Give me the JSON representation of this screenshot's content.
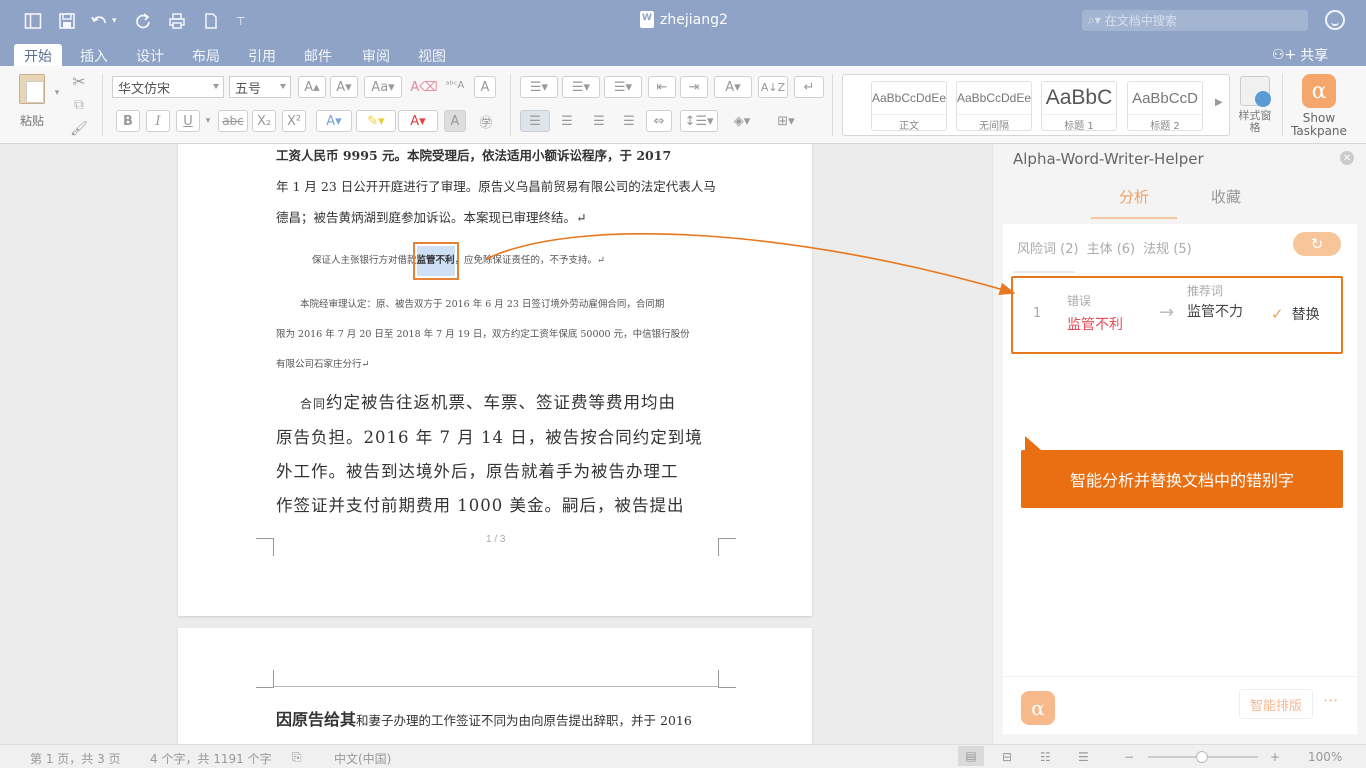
{
  "titlebar": {
    "doc_title": "zhejiang2",
    "search_placeholder": "在文档中搜索"
  },
  "tabs": [
    {
      "label": "开始",
      "active": true
    },
    {
      "label": "插入"
    },
    {
      "label": "设计"
    },
    {
      "label": "布局"
    },
    {
      "label": "引用"
    },
    {
      "label": "邮件"
    },
    {
      "label": "审阅"
    },
    {
      "label": "视图"
    }
  ],
  "share_label": "共享",
  "ribbon": {
    "paste_label": "粘贴",
    "font_name": "华文仿宋",
    "font_size": "五号",
    "styles": [
      {
        "sample": "AaBbCcDdEe",
        "name": "正文"
      },
      {
        "sample": "AaBbCcDdEe",
        "name": "无间隔"
      },
      {
        "sample": "AaBbC",
        "name": "标题 1"
      },
      {
        "sample": "AaBbCcD",
        "name": "标题 2"
      }
    ],
    "styles_pane_label": "样式窗格",
    "taskpane_label": "Show Taskpane"
  },
  "document": {
    "p1_line1": "工资人民币 9995 元。本院受理后，依法适用小额诉讼程序，于 2017",
    "p1_line2": "年 1 月 23 日公开开庭进行了审理。原告义乌昌前贸易有限公司的法定代表人马",
    "p1_line3": "德昌；被告黄炳湖到庭参加诉讼。本案现已审理终结。↵",
    "p2_before": "保证人主张银行方对借款",
    "p2_highlight": "监管不利",
    "p2_after": "，应免除保证责任的，不予支持。↵",
    "p3_line1": "本院经审理认定：原、被告双方于 2016 年 6 月 23 日签订境外劳动雇佣合同，合同期",
    "p3_line2": "限为 2016 年 7 月 20 日至 2018 年 7 月 19 日，双方约定工资年保底 50000 元，中信银行股份",
    "p3_line3": "有限公司石家庄分行↵",
    "p4_prefix": "合同",
    "p4_line1": "约定被告往返机票、车票、签证费等费用均由",
    "p4_line2": "原告负担。2016 年 7 月 14 日，被告按合同约定到境",
    "p4_line3": "外工作。被告到达境外后，原告就着手为被告办理工",
    "p4_line4": "作签证并支付前期费用 1000 美金。嗣后，被告提出",
    "page_number": "1 / 3",
    "page2_bold": "因原告给其",
    "page2_rest": "和妻子办理的工作签证不同为由向原告提出辞职，并于 2016"
  },
  "panel": {
    "title": "Alpha-Word-Writer-Helper",
    "tabs": [
      "分析",
      "收藏"
    ],
    "filters": [
      "风险词 (2)",
      "主体 (6)",
      "法规 (5)"
    ],
    "result": {
      "index": "1",
      "error_label": "错误",
      "error_word": "监管不利",
      "recommend_label": "推荐词",
      "recommend_word": "监管不力",
      "replace_label": "替换"
    },
    "callout": "智能分析并替换文档中的错别字",
    "smart_layout_label": "智能排版",
    "more_label": "···"
  },
  "statusbar": {
    "page_info": "第 1 页，共 3 页",
    "word_count": "4 个字，共 1191 个字",
    "language": "中文(中国)",
    "zoom": "100%"
  },
  "colors": {
    "titlebar": "#8ea3c6",
    "accent_orange": "#e96f12",
    "error_red": "#e84d55"
  }
}
